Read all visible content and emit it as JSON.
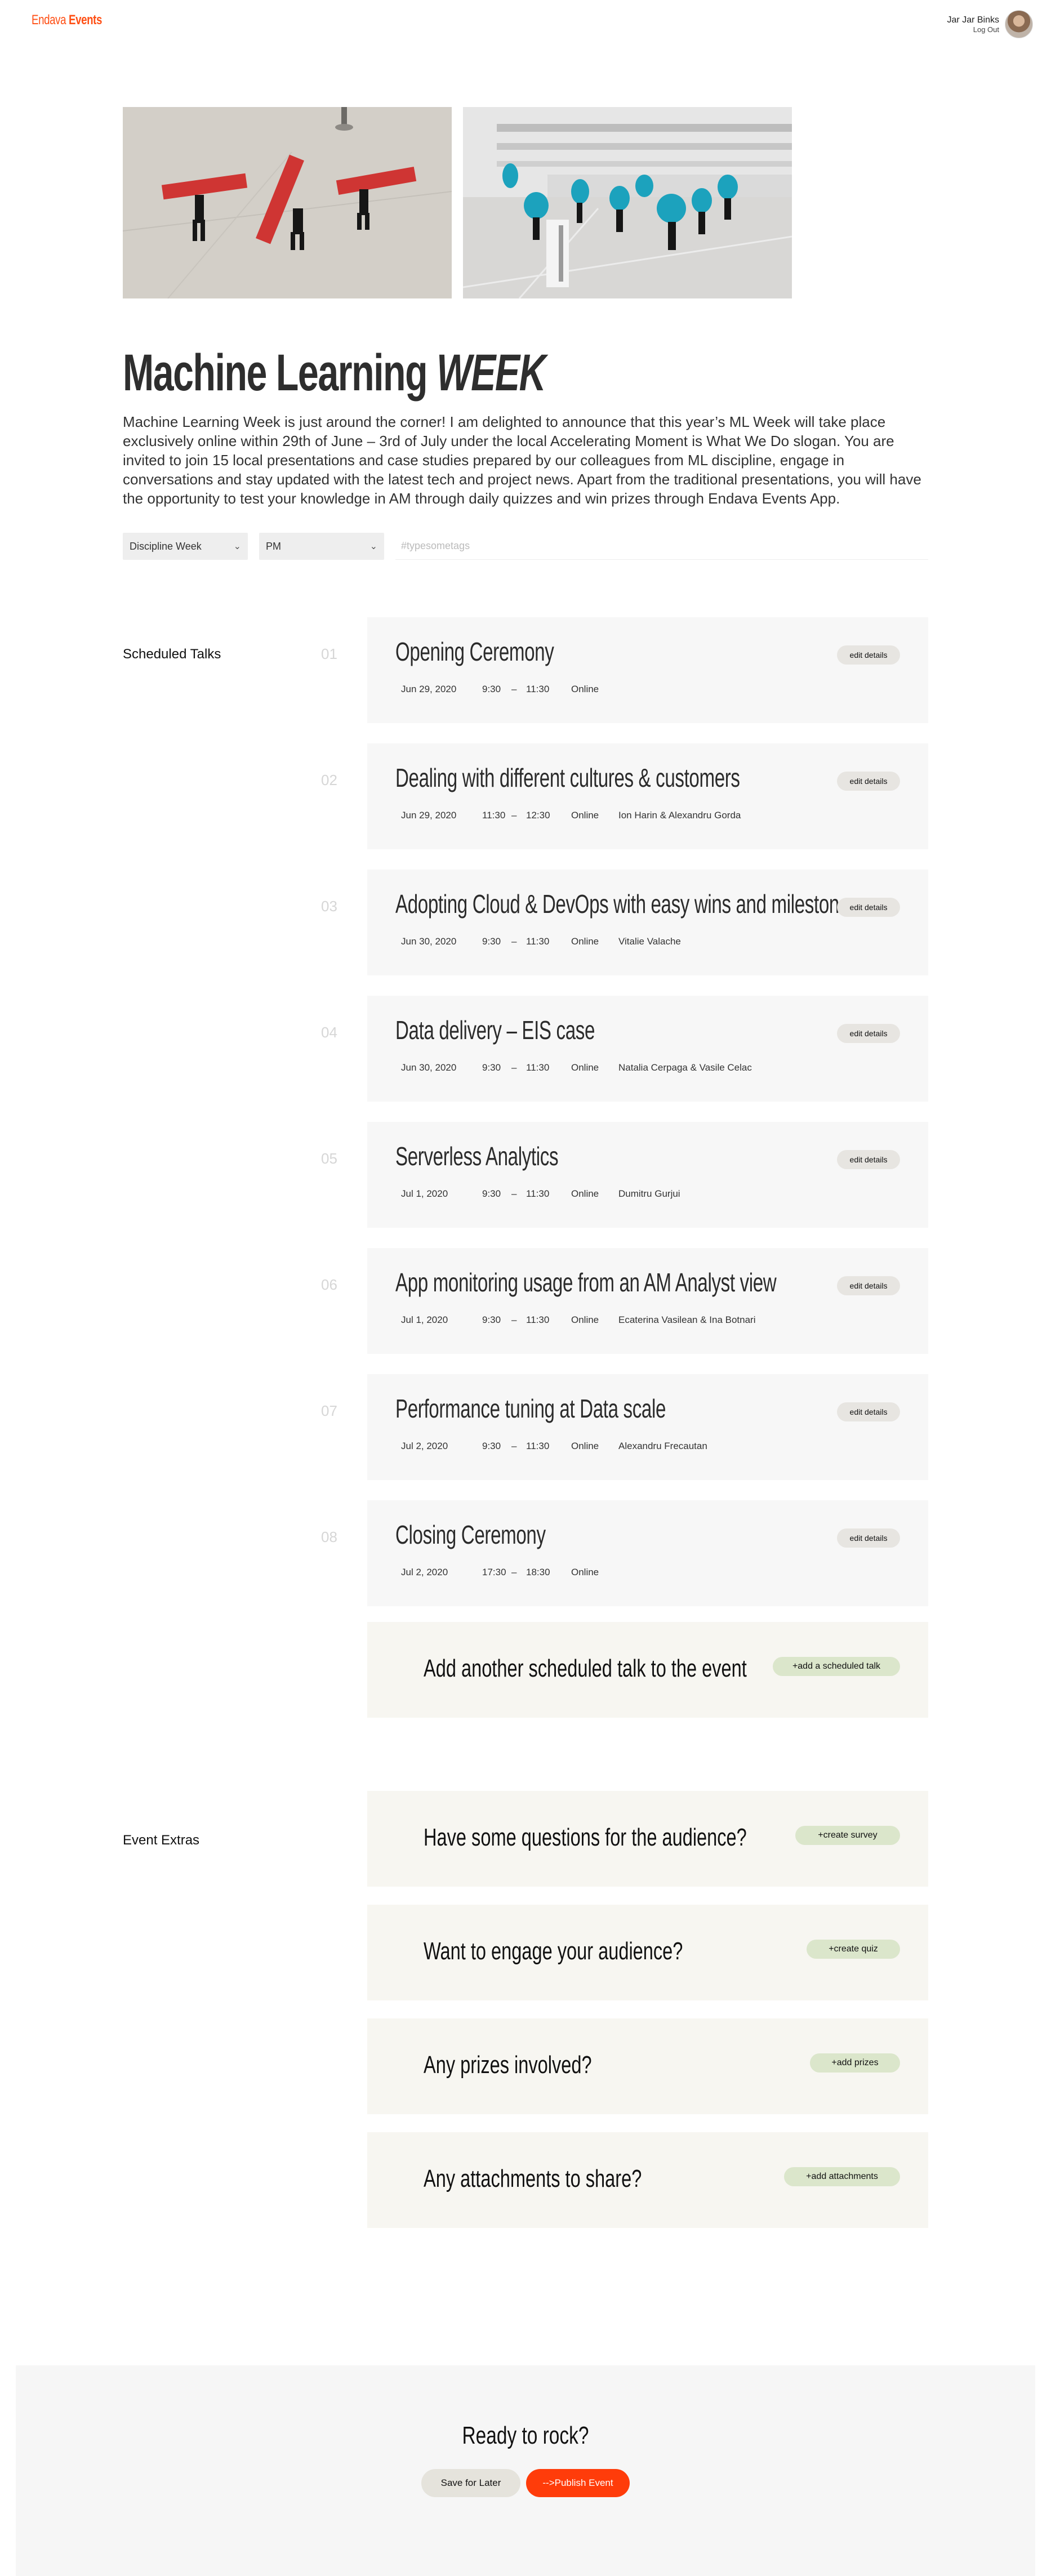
{
  "header": {
    "brand_left": "Endava",
    "brand_right": "Events",
    "user_name": "Jar Jar Binks",
    "logout_label": "Log Out"
  },
  "event": {
    "title_main": "Machine Learning ",
    "title_week": "WEEK",
    "description": "Machine Learning Week is just around the corner! I am delighted to announce that this year’s ML Week will take place exclusively online within 29th of June – 3rd of July under the local Accelerating Moment is What We Do slogan. You are invited to join 15 local presentations and case studies prepared by our colleagues from ML discipline, engage in conversations and stay updated with the latest tech and project news. Apart from the traditional presentations, you will have the opportunity to test your knowledge in AM through daily quizzes and win prizes through Endava Events App."
  },
  "filters": {
    "type_value": "Discipline Week",
    "discipline_value": "PM",
    "tags_placeholder": "#typesometags"
  },
  "talks_section": {
    "label": "Scheduled Talks",
    "edit_label": "edit details",
    "talks": [
      {
        "num": "01",
        "title": "Opening Ceremony",
        "date": "Jun 29, 2020",
        "start": "9:30",
        "end": "11:30",
        "location": "Online",
        "speakers": ""
      },
      {
        "num": "02",
        "title": "Dealing with different cultures & customers",
        "date": "Jun 29, 2020",
        "start": "11:30",
        "end": "12:30",
        "location": "Online",
        "speakers": "Ion Harin & Alexandru Gorda"
      },
      {
        "num": "03",
        "title": "Adopting Cloud & DevOps with easy wins and milestone...",
        "date": "Jun 30, 2020",
        "start": "9:30",
        "end": "11:30",
        "location": "Online",
        "speakers": "Vitalie Valache"
      },
      {
        "num": "04",
        "title": "Data delivery – EIS case",
        "date": "Jun 30, 2020",
        "start": "9:30",
        "end": "11:30",
        "location": "Online",
        "speakers": "Natalia Cerpaga & Vasile Celac"
      },
      {
        "num": "05",
        "title": "Serverless Analytics",
        "date": "Jul 1, 2020",
        "start": "9:30",
        "end": "11:30",
        "location": "Online",
        "speakers": "Dumitru Gurjui"
      },
      {
        "num": "06",
        "title": "App monitoring usage from an AM Analyst view",
        "date": "Jul 1, 2020",
        "start": "9:30",
        "end": "11:30",
        "location": "Online",
        "speakers": "Ecaterina Vasilean & Ina Botnari"
      },
      {
        "num": "07",
        "title": "Performance tuning at Data scale",
        "date": "Jul 2, 2020",
        "start": "9:30",
        "end": "11:30",
        "location": "Online",
        "speakers": "Alexandru Frecautan"
      },
      {
        "num": "08",
        "title": "Closing Ceremony",
        "date": "Jul 2, 2020",
        "start": "17:30",
        "end": "18:30",
        "location": "Online",
        "speakers": ""
      }
    ],
    "time_separator": "–",
    "add_text": "Add another scheduled talk to the event",
    "add_button": "+add a scheduled talk"
  },
  "extras_section": {
    "label": "Event Extras",
    "items": [
      {
        "text": "Have some questions for the audience?",
        "button": "+create survey"
      },
      {
        "text": "Want to engage your audience?",
        "button": "+create quiz"
      },
      {
        "text": "Any prizes involved?",
        "button": "+add prizes"
      },
      {
        "text": "Any attachments to share?",
        "button": "+add attachments"
      }
    ]
  },
  "footer": {
    "heading": "Ready to rock?",
    "save_label": "Save for Later",
    "publish_label": "-->Publish Event"
  },
  "colors": {
    "brand": "#ff4f14",
    "publish": "#ff3c0a",
    "green_pill": "#dbe6cb",
    "card_bg": "#f7f7f7",
    "muted_number": "#d6d6d6"
  },
  "icons": {
    "dropdown": "chevron-down-icon"
  }
}
